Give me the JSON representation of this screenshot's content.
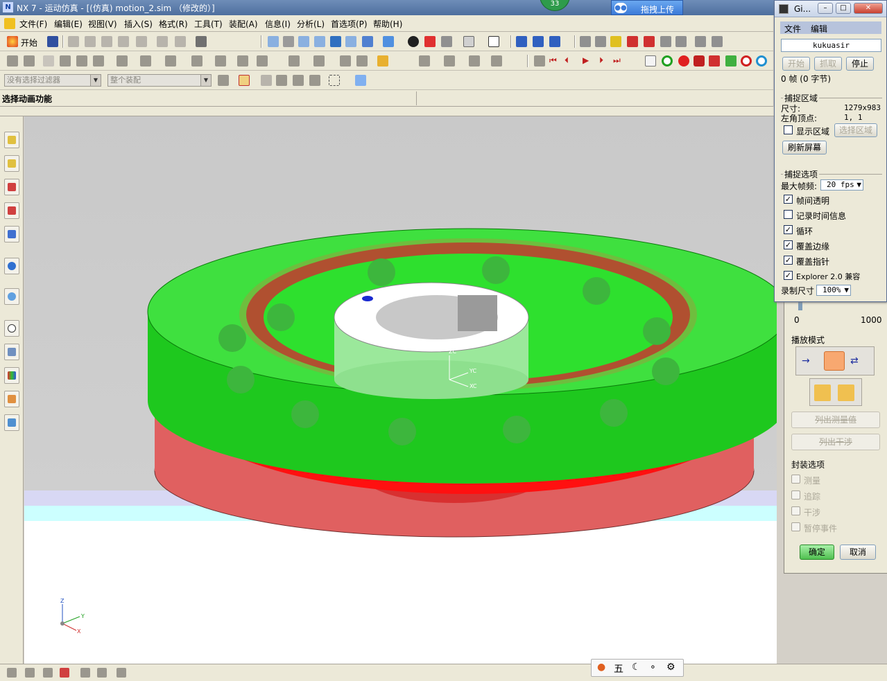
{
  "window": {
    "title": "NX 7 - 运动仿真 - [(仿真) motion_2.sim （修改的）]",
    "app_logo": "N",
    "badge": "33",
    "upload_label": "拖拽上传"
  },
  "menu": [
    "文件(F)",
    "编辑(E)",
    "视图(V)",
    "插入(S)",
    "格式(R)",
    "工具(T)",
    "装配(A)",
    "信息(I)",
    "分析(L)",
    "首选项(P)",
    "帮助(H)"
  ],
  "toolbar": {
    "start_label": "开始",
    "filter_placeholder": "没有选择过滤器",
    "assembly_placeholder": "整个装配"
  },
  "cue_line": "选择动画功能",
  "viewport": {
    "triad_labels": {
      "z": "Z",
      "y": "Y",
      "x": "X"
    },
    "wcs_labels": {
      "zc": "ZC",
      "yc": "YC",
      "xc": "XC"
    },
    "colors": {
      "green_part": "#2ee02e",
      "red_part": "#e05050",
      "white_part": "#ffffff",
      "balls": "#3db63d"
    }
  },
  "motion_panel": {
    "scale_min": "0",
    "scale_max": "1000",
    "playback_mode_label": "播放模式",
    "list_measure_label": "列出测量值",
    "list_interference_label": "列出干涉",
    "encapsulate_label": "封装选项",
    "options": [
      "测量",
      "追踪",
      "干涉",
      "暂停事件"
    ],
    "ok_label": "确定",
    "cancel_label": "取消"
  },
  "capture": {
    "title": "Gi...",
    "menu": [
      "文件",
      "编辑"
    ],
    "name": "kukuasir",
    "start_label": "开始",
    "grab_label": "抓取",
    "stop_label": "停止",
    "frame_info": "0 帧 (0 字节)",
    "capture_area_label": "捕捉区域",
    "size_label": "尺寸:",
    "size_value": "1279x983",
    "corner_label": "左角顶点:",
    "corner_value": "1, 1",
    "show_area_label": "显示区域",
    "select_area_label": "选择区域",
    "refresh_label": "刷新屏幕",
    "capture_options_label": "捕捉选项",
    "max_fps_label": "最大帧频:",
    "max_fps_value": "20 fps",
    "options": [
      {
        "label": "帧间透明",
        "checked": true
      },
      {
        "label": "记录时间信息",
        "checked": false
      },
      {
        "label": "循环",
        "checked": true
      },
      {
        "label": "覆盖边缘",
        "checked": true
      },
      {
        "label": "覆盖指针",
        "checked": true
      },
      {
        "label": "Explorer 2.0 兼容",
        "checked": true
      }
    ],
    "record_size_label": "录制尺寸",
    "record_size_value": "100%"
  },
  "ime": {
    "lang_char": "五"
  }
}
